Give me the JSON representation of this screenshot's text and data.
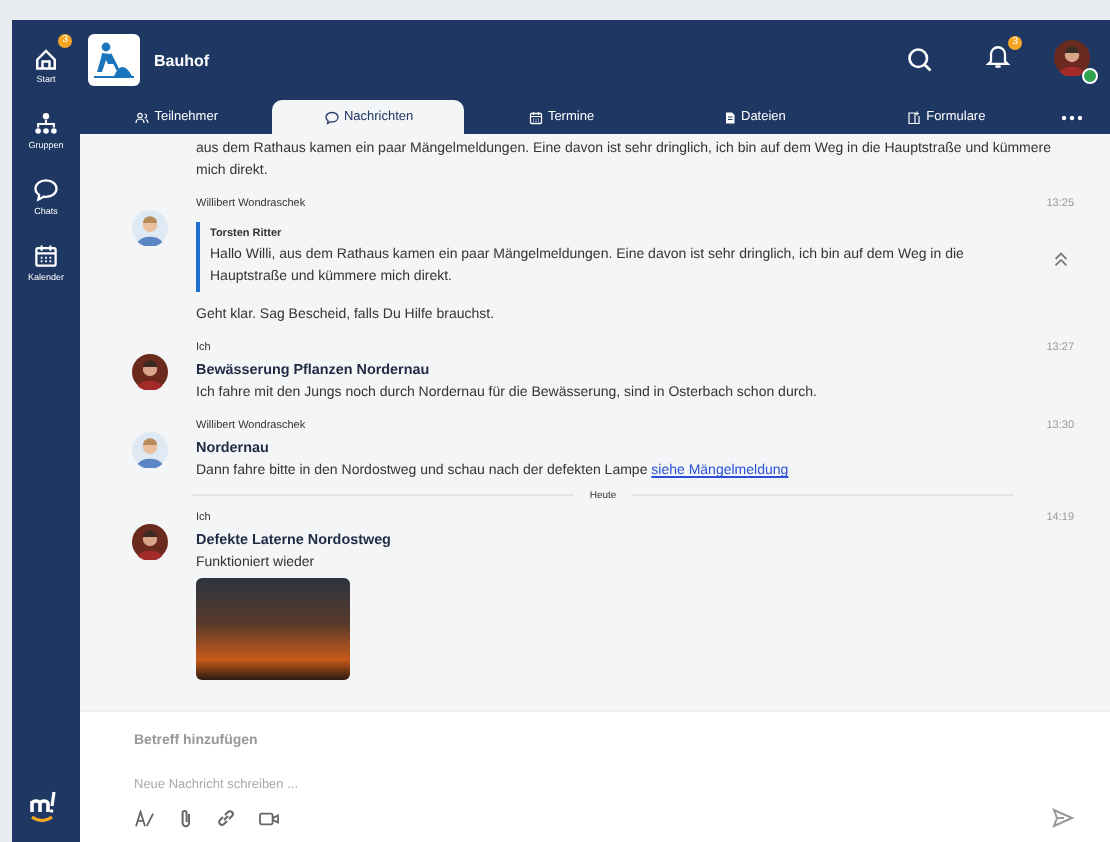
{
  "sidebar": {
    "items": [
      {
        "label": "Start",
        "badge": "3",
        "selected": false
      },
      {
        "label": "Gruppen",
        "selected": false
      },
      {
        "label": "Chats",
        "selected": false
      },
      {
        "label": "Kalender",
        "selected": false
      }
    ]
  },
  "header": {
    "title": "Bauhof",
    "notification_badge": "3",
    "online": true
  },
  "tabs": [
    {
      "label": "Teilnehmer",
      "selected": false
    },
    {
      "label": "Nachrichten",
      "selected": true
    },
    {
      "label": "Termine",
      "selected": false
    },
    {
      "label": "Dateien",
      "selected": false
    },
    {
      "label": "Formulare",
      "selected": false
    }
  ],
  "messages": [
    {
      "kind": "continued",
      "body": "aus dem Rathaus kamen ein paar Mängelmeldungen. Eine davon ist sehr dringlich, ich bin auf dem Weg in die Hauptstraße und kümmere mich direkt."
    },
    {
      "kind": "received",
      "sender": "Willibert Wondraschek",
      "time": "13:25",
      "quote": {
        "author": "Torsten Ritter",
        "text": "Hallo Willi, aus dem Rathaus kamen ein paar Mängelmeldungen. Eine davon ist sehr dringlich, ich bin auf dem Weg in die Hauptstraße und kümmere mich direkt."
      },
      "body": "Geht klar. Sag Bescheid, falls Du Hilfe brauchst."
    },
    {
      "kind": "sent",
      "sender": "Ich",
      "time": "13:27",
      "subject": "Bewässerung Pflanzen Nordernau",
      "body": "Ich fahre mit den Jungs noch durch Nordernau für die Bewässerung, sind in Osterbach schon durch."
    },
    {
      "kind": "received",
      "sender": "Willibert Wondraschek",
      "time": "13:30",
      "subject": "Nordernau",
      "body": "Dann fahre bitte in den Nordostweg und schau nach der defekten Lampe",
      "link": "siehe Mängelmeldung"
    },
    {
      "kind": "divider",
      "label": "Heute"
    },
    {
      "kind": "sent",
      "sender": "Ich",
      "time": "14:19",
      "subject": "Defekte Laterne Nordostweg",
      "body": "Funktioniert wieder",
      "photo": true
    }
  ],
  "composer": {
    "subject_placeholder": "Betreff hinzufügen",
    "message_placeholder": "Neue Nachricht schreiben ..."
  }
}
